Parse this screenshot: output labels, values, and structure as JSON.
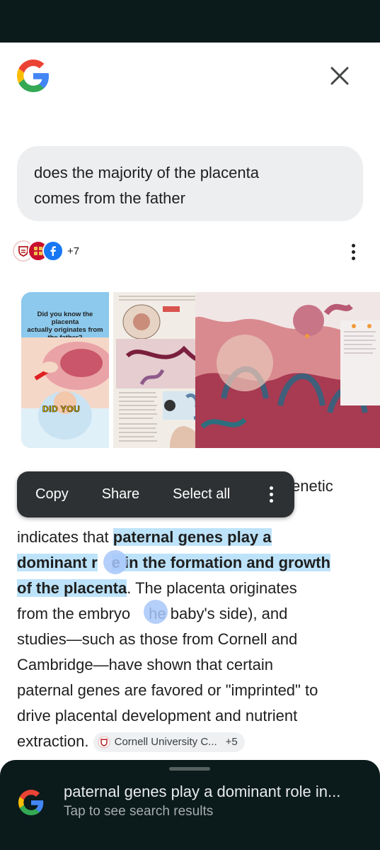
{
  "query": {
    "line1": "does the majority of the placenta",
    "line2": "comes from the father"
  },
  "sources": {
    "more_count": "+7"
  },
  "image_strip": {
    "tile1": {
      "caption_line1": "Did you know the placenta",
      "caption_line2": "actually originates from",
      "caption_line3": "the father?",
      "badge": "DID YOU"
    }
  },
  "answer": {
    "line1_end": "enetic",
    "line2_pre": "indicates that ",
    "line2_hl": "paternal genes play a",
    "line3_hl_a": "dominant r",
    "line3_hl_b": "e in the formation and growth",
    "line4_hl": "of the placenta",
    "line4_post": ". The placenta originates",
    "line5_a": "from the embryo",
    "line5_b": "he baby's side), and",
    "line6": "studies—such as those from Cornell and",
    "line7": "Cambridge—have shown that certain",
    "line8": "paternal genes are favored or \"imprinted\" to",
    "line9": "drive placental development and nutrient",
    "line10": "extraction.",
    "citation_label": "Cornell University C...",
    "citation_more": "+5"
  },
  "context_menu": {
    "copy": "Copy",
    "share": "Share",
    "select_all": "Select all"
  },
  "bottom_sheet": {
    "title": "paternal genes play a dominant role in...",
    "subtitle": "Tap to see search results"
  },
  "colors": {
    "status_bar": "#0b1a1b",
    "highlight": "#bde3fa",
    "menu_bg": "#2e3133",
    "bubble_bg": "#eceeef"
  }
}
